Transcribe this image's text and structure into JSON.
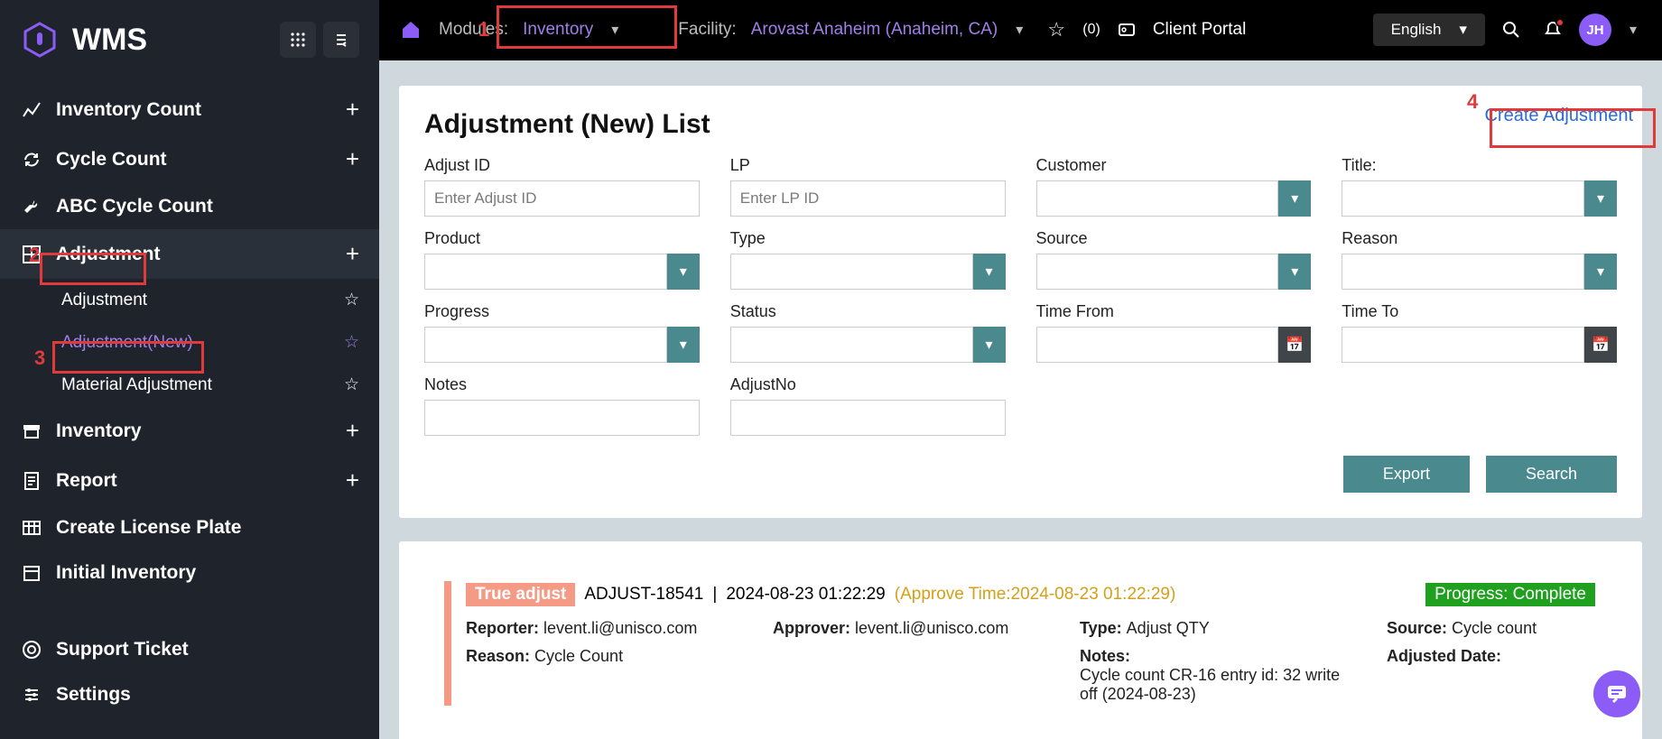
{
  "app": {
    "name": "WMS"
  },
  "sidebar": {
    "items": [
      {
        "label": "Inventory Count"
      },
      {
        "label": "Cycle Count"
      },
      {
        "label": "ABC Cycle Count"
      },
      {
        "label": "Adjustment"
      },
      {
        "label": "Inventory"
      },
      {
        "label": "Report"
      },
      {
        "label": "Create License Plate"
      },
      {
        "label": "Initial Inventory"
      }
    ],
    "adjustment_sub": [
      {
        "label": "Adjustment"
      },
      {
        "label": "Adjustment(New)"
      },
      {
        "label": "Material Adjustment"
      }
    ],
    "footer": [
      {
        "label": "Support Ticket"
      },
      {
        "label": "Settings"
      }
    ]
  },
  "topbar": {
    "modules_label": "Modules:",
    "modules_value": "Inventory",
    "facility_label": "Facility:",
    "facility_value": "Arovast Anaheim  (Anaheim, CA)",
    "favorites": "(0)",
    "client_portal": "Client Portal",
    "language": "English",
    "avatar": "JH"
  },
  "page": {
    "title": "Adjustment (New) List",
    "create_link": "Create Adjustment",
    "filters": {
      "adjust_id": {
        "label": "Adjust ID",
        "placeholder": "Enter Adjust ID"
      },
      "lp": {
        "label": "LP",
        "placeholder": "Enter LP ID"
      },
      "customer": {
        "label": "Customer"
      },
      "title": {
        "label": "Title:"
      },
      "product": {
        "label": "Product"
      },
      "type": {
        "label": "Type"
      },
      "source": {
        "label": "Source"
      },
      "reason": {
        "label": "Reason"
      },
      "progress": {
        "label": "Progress"
      },
      "status": {
        "label": "Status"
      },
      "time_from": {
        "label": "Time From"
      },
      "time_to": {
        "label": "Time To"
      },
      "notes": {
        "label": "Notes"
      },
      "adjust_no": {
        "label": "AdjustNo"
      }
    },
    "buttons": {
      "export": "Export",
      "search": "Search"
    }
  },
  "result": {
    "true_badge": "True adjust",
    "adjust_id": "ADJUST-18541",
    "timestamp": "2024-08-23 01:22:29",
    "approve_time": "(Approve Time:2024-08-23 01:22:29)",
    "progress_badge": "Progress: Complete",
    "reporter_label": "Reporter: ",
    "reporter": "levent.li@unisco.com",
    "approver_label": "Approver: ",
    "approver": "levent.li@unisco.com",
    "type_label": "Type: ",
    "type": "Adjust QTY",
    "source_label": "Source: ",
    "source": "Cycle count",
    "reason_label": "Reason: ",
    "reason": "Cycle Count",
    "notes_label": "Notes:",
    "notes": "Cycle count CR-16 entry id: 32 write off (2024-08-23)",
    "adjusted_date_label": "Adjusted Date:"
  },
  "annotations": {
    "n1": "1",
    "n2": "2",
    "n3": "3",
    "n4": "4"
  }
}
